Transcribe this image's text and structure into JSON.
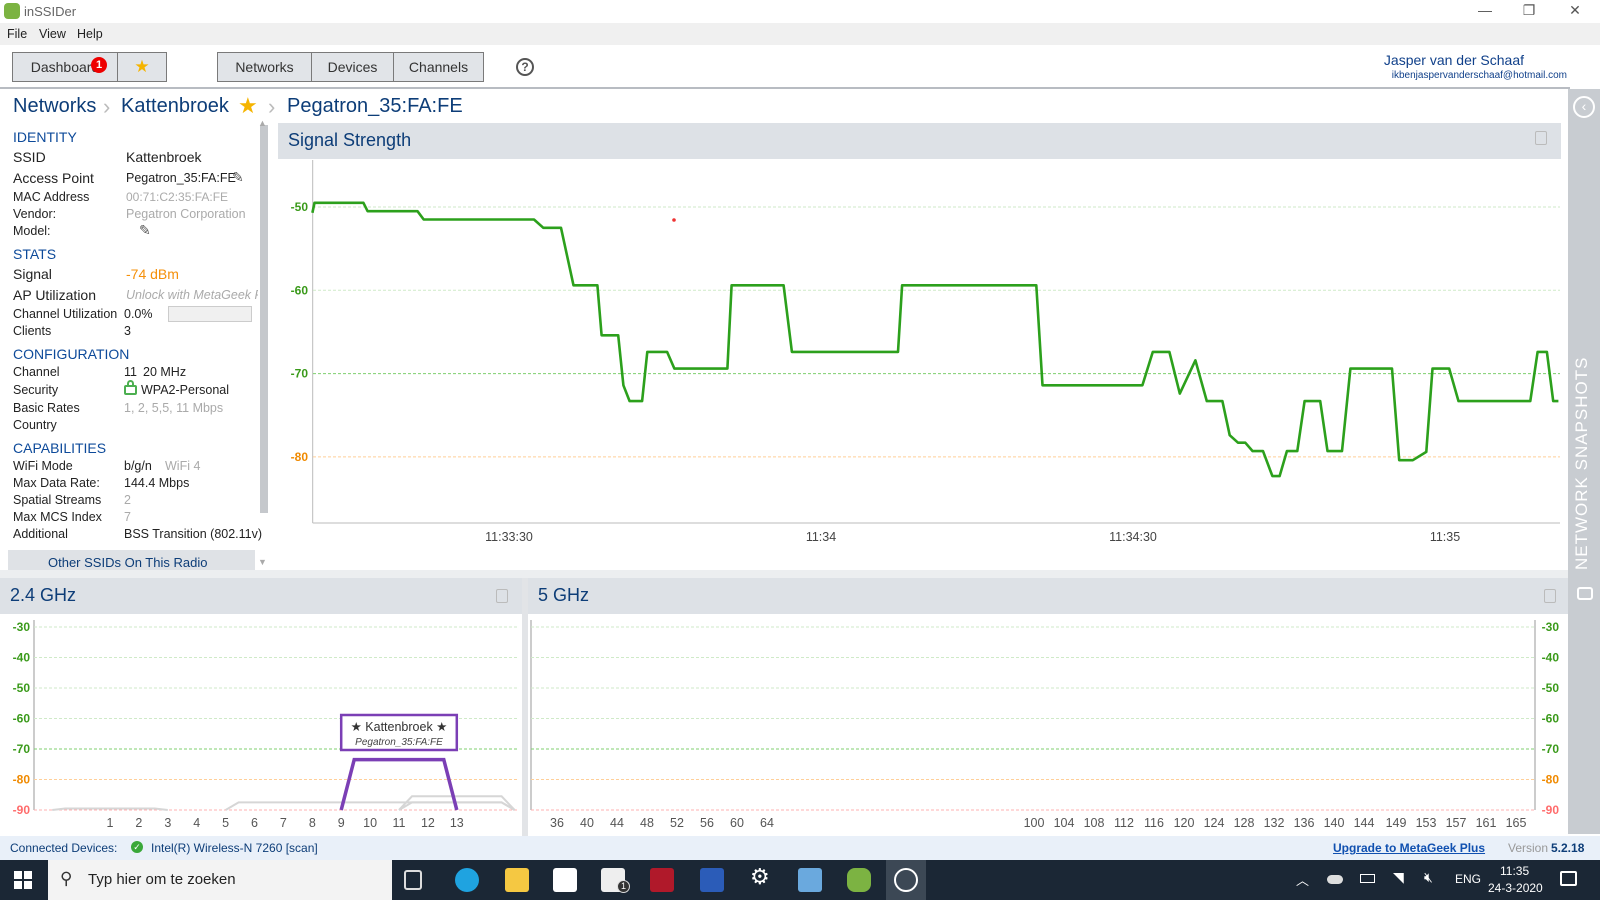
{
  "window": {
    "title": "inSSIDer",
    "controls": [
      "—",
      "❐",
      "✕"
    ]
  },
  "menu": [
    "File",
    "View",
    "Help"
  ],
  "toolbar": {
    "dashboard": "Dashboard",
    "badge": "1",
    "favorites": "★",
    "networks": "Networks",
    "devices": "Devices",
    "channels": "Channels",
    "help": "?"
  },
  "user": {
    "name": "Jasper van der Schaaf",
    "email": "ikbenjaspervanderschaaf@hotmail.com"
  },
  "breadcrumb": [
    "Networks",
    "Kattenbroek",
    "Pegatron_35:FA:FE"
  ],
  "details": {
    "identity": {
      "header": "IDENTITY",
      "ssid_label": "SSID",
      "ssid": "Kattenbroek",
      "ap_label": "Access Point",
      "ap": "Pegatron_35:FA:FE",
      "mac_label": "MAC Address",
      "mac": "00:71:C2:35:FA:FE",
      "vendor_label": "Vendor:",
      "vendor": "Pegatron Corporation",
      "model_label": "Model:"
    },
    "stats": {
      "header": "STATS",
      "signal_label": "Signal",
      "signal": "-74 dBm",
      "ap_util_label": "AP Utilization",
      "ap_util": "Unlock with MetaGeek Plus",
      "chan_util_label": "Channel Utilization",
      "chan_util": "0.0%",
      "chan_util_fraction": 0.0,
      "clients_label": "Clients",
      "clients": "3"
    },
    "configuration": {
      "header": "CONFIGURATION",
      "channel_label": "Channel",
      "channel": "11",
      "width": "20 MHz",
      "security_label": "Security",
      "security": "WPA2-Personal",
      "basic_rates_label": "Basic Rates",
      "basic_rates": "1, 2, 5,5, 11 Mbps",
      "country_label": "Country"
    },
    "capabilities": {
      "header": "CAPABILITIES",
      "wifi_mode_label": "WiFi Mode",
      "wifi_mode": "b/g/n",
      "wifi_gen": "WiFi 4",
      "max_rate_label": "Max Data Rate:",
      "max_rate": "144.4 Mbps",
      "streams_label": "Spatial Streams",
      "streams": "2",
      "mcs_label": "Max MCS Index",
      "mcs": "7",
      "additional_label": "Additional",
      "additional": "BSS Transition (802.11v)"
    },
    "other_ssids": "Other SSIDs On This Radio"
  },
  "side_strip": {
    "label": "NETWORK SNAPSHOTS"
  },
  "status": {
    "connected_label": "Connected Devices:",
    "device": "Intel(R) Wireless-N 7260 [scan]",
    "upgrade": "Upgrade to MetaGeek Plus",
    "version_label": "Version",
    "version": "5.2.18"
  },
  "taskbar": {
    "search_placeholder": "Typ hier om te zoeken",
    "time": "11:35",
    "date": "24-3-2020",
    "lang": "ENG",
    "mail_badge": "1"
  },
  "colors": {
    "accent": "#0d3d78",
    "signal_line": "#2ca01c",
    "selected_network": "#7b3fb5",
    "good": "#3a9a1a",
    "warn": "#f08a00",
    "bad": "#ff6b6b"
  },
  "chart_data": [
    {
      "type": "line",
      "title": "Signal Strength",
      "ylim": [
        -88,
        -47
      ],
      "yticks": [
        -50,
        -60,
        -70,
        -80
      ],
      "xticks": [
        "11:33:30",
        "11:34",
        "11:34:30",
        "11:35"
      ],
      "grid": true,
      "series": [
        {
          "points": [
            [
              "11:33:11.1",
              -50.7
            ],
            [
              "11:33:11.3",
              -49.5
            ],
            [
              "11:33:16.0",
              -49.5
            ],
            [
              "11:33:16.4",
              -50.5
            ],
            [
              "11:33:21.2",
              -50.5
            ],
            [
              "11:33:21.8",
              -51.5
            ],
            [
              "11:33:32.4",
              -51.5
            ],
            [
              "11:33:33.3",
              -52.5
            ],
            [
              "11:33:35.0",
              -52.5
            ],
            [
              "11:33:36.2",
              -59.4
            ],
            [
              "11:33:38.5",
              -59.4
            ],
            [
              "11:33:38.9",
              -65.4
            ],
            [
              "11:33:40.5",
              -65.4
            ],
            [
              "11:33:41.0",
              -71.4
            ],
            [
              "11:33:41.6",
              -73.3
            ],
            [
              "11:33:42.8",
              -73.3
            ],
            [
              "11:33:43.3",
              -67.4
            ],
            [
              "11:33:45.2",
              -67.4
            ],
            [
              "11:33:45.9",
              -69.4
            ],
            [
              "11:33:51.0",
              -69.4
            ],
            [
              "11:33:51.4",
              -59.4
            ],
            [
              "11:33:56.4",
              -59.4
            ],
            [
              "11:33:57.2",
              -67.4
            ],
            [
              "11:34:07.4",
              -67.4
            ],
            [
              "11:34:07.8",
              -59.4
            ],
            [
              "11:34:20.7",
              -59.4
            ],
            [
              "11:34:21.3",
              -71.4
            ],
            [
              "11:34:30.9",
              -71.4
            ],
            [
              "11:34:31.9",
              -67.4
            ],
            [
              "11:34:33.5",
              -67.4
            ],
            [
              "11:34:34.5",
              -72.4
            ],
            [
              "11:34:36.0",
              -68.4
            ],
            [
              "11:34:37.1",
              -73.3
            ],
            [
              "11:34:38.6",
              -73.3
            ],
            [
              "11:34:39.3",
              -77.4
            ],
            [
              "11:34:40.1",
              -78.3
            ],
            [
              "11:34:40.8",
              -78.3
            ],
            [
              "11:34:41.5",
              -79.3
            ],
            [
              "11:34:42.5",
              -79.3
            ],
            [
              "11:34:43.4",
              -82.3
            ],
            [
              "11:34:44.1",
              -82.3
            ],
            [
              "11:34:44.8",
              -79.3
            ],
            [
              "11:34:45.8",
              -79.3
            ],
            [
              "11:34:46.5",
              -73.3
            ],
            [
              "11:34:48.0",
              -73.3
            ],
            [
              "11:34:48.7",
              -79.3
            ],
            [
              "11:34:50.1",
              -79.3
            ],
            [
              "11:34:50.9",
              -69.4
            ],
            [
              "11:34:54.9",
              -69.4
            ],
            [
              "11:34:55.6",
              -80.4
            ],
            [
              "11:34:56.9",
              -80.4
            ],
            [
              "11:34:58.2",
              -79.4
            ],
            [
              "11:34:58.8",
              -69.4
            ],
            [
              "11:35:00.4",
              -69.4
            ],
            [
              "11:35:01.3",
              -73.3
            ],
            [
              "11:35:08.2",
              -73.3
            ],
            [
              "11:35:08.9",
              -67.4
            ],
            [
              "11:35:09.8",
              -67.4
            ],
            [
              "11:35:10.4",
              -73.3
            ],
            [
              "11:35:10.9",
              -73.3
            ]
          ]
        }
      ]
    },
    {
      "type": "area",
      "title": "2.4 GHz",
      "ylim": [
        -90,
        -30
      ],
      "yticks": [
        -30,
        -40,
        -50,
        -60,
        -70,
        -80,
        -90
      ],
      "categories": [
        "1",
        "2",
        "3",
        "4",
        "5",
        "6",
        "7",
        "8",
        "9",
        "10",
        "11",
        "12",
        "13"
      ],
      "networks": [
        {
          "ssid": "Kattenbroek",
          "bssid": "Pegatron_35:FA:FE",
          "channel": 11,
          "half_span": 2,
          "signal": -73.5,
          "selected": true
        },
        {
          "channel": 1,
          "half_span": 2,
          "signal": -89.5
        },
        {
          "channel": 10,
          "half_span": 5,
          "signal": -87.5
        },
        {
          "channel": 13,
          "half_span": 2,
          "signal": -85.5
        },
        {
          "channel": 13,
          "half_span": 2,
          "signal": -87.5
        }
      ]
    },
    {
      "type": "area",
      "title": "5 GHz",
      "ylim": [
        -90,
        -30
      ],
      "yticks": [
        -30,
        -40,
        -50,
        -60,
        -70,
        -80,
        -90
      ],
      "categories": [
        "36",
        "40",
        "44",
        "48",
        "52",
        "56",
        "60",
        "64",
        "100",
        "104",
        "108",
        "112",
        "116",
        "120",
        "124",
        "128",
        "132",
        "136",
        "140",
        "144",
        "149",
        "153",
        "157",
        "161",
        "165"
      ],
      "networks": []
    }
  ]
}
